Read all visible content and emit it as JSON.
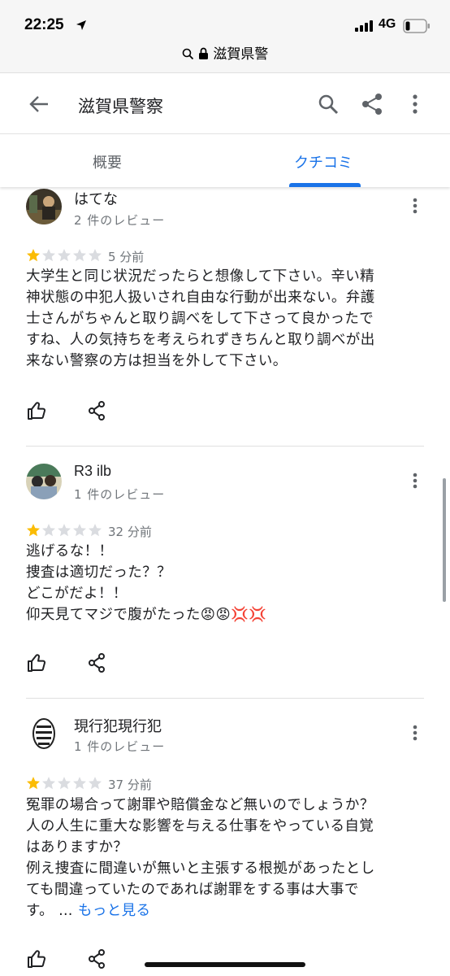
{
  "status_bar": {
    "time": "22:25",
    "network": "4G"
  },
  "address_bar": {
    "url": "滋賀県警"
  },
  "app_bar": {
    "title": "滋賀県警察"
  },
  "tabs": [
    {
      "label": "概要"
    },
    {
      "label": "クチコミ"
    }
  ],
  "colors": {
    "accent": "#1a73e8",
    "star_filled": "#fbbc04",
    "star_empty": "#dadce0"
  },
  "reviews": [
    {
      "author": "はてな",
      "review_count": "2 件のレビュー",
      "rating": 1,
      "time": "5 分前",
      "lines": [
        "大学生と同じ状況だったらと想像して下さい。辛い精",
        "神状態の中犯人扱いされ自由な行動が出来ない。弁護",
        "士さんがちゃんと取り調べをして下さって良かったで",
        "すね、人の気持ちを考えられずきちんと取り調べが出",
        "来ない警察の方は担当を外して下さい。"
      ]
    },
    {
      "author": "R3 ilb",
      "review_count": "1 件のレビュー",
      "rating": 1,
      "time": "32 分前",
      "lines": [
        "逃げるな！！",
        "捜査は適切だった？？",
        "どこがだよ！！",
        "仰天見てマジで腹がたった😡😡💢💢"
      ]
    },
    {
      "author": "現行犯現行犯",
      "review_count": "1 件のレビュー",
      "rating": 1,
      "time": "37 分前",
      "lines": [
        "冤罪の場合って謝罪や賠償金など無いのでしょうか？",
        "人の人生に重大な影響を与える仕事をやっている自覚",
        "はありますか？",
        "例え捜査に間違いが無いと主張する根拠があったとし",
        "ても間違っていたのであれば謝罪をする事は大事で",
        "す。 … "
      ],
      "more_label": "もっと見る"
    }
  ]
}
